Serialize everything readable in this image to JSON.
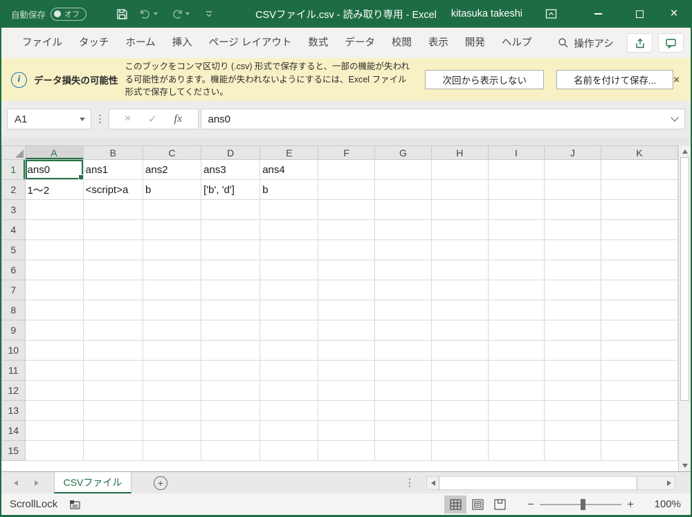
{
  "window": {
    "title": "CSVファイル.csv  -  読み取り専用  -  Excel",
    "user": "kitasuka takeshi"
  },
  "titlebar": {
    "autosave_label": "自動保存",
    "autosave_state": "オフ"
  },
  "ribbon": {
    "tabs": [
      {
        "id": "file",
        "label": "ファイル"
      },
      {
        "id": "touch",
        "label": "タッチ"
      },
      {
        "id": "home",
        "label": "ホーム"
      },
      {
        "id": "insert",
        "label": "挿入"
      },
      {
        "id": "page-layout",
        "label": "ページ レイアウト"
      },
      {
        "id": "formulas",
        "label": "数式"
      },
      {
        "id": "data",
        "label": "データ"
      },
      {
        "id": "review",
        "label": "校閲"
      },
      {
        "id": "view",
        "label": "表示"
      },
      {
        "id": "developer",
        "label": "開発"
      },
      {
        "id": "help",
        "label": "ヘルプ"
      }
    ],
    "search_label": "操作アシ"
  },
  "message_bar": {
    "title": "データ損失の可能性",
    "message": "このブックをコンマ区切り (.csv) 形式で保存すると、一部の機能が失われる可能性があります。機能が失われないようにするには、Excel ファイル形式で保存してください。",
    "dismiss_button": "次回から表示しない",
    "save_as_button": "名前を付けて保存...",
    "close_glyph": "×"
  },
  "formula_bar": {
    "name_box": "A1",
    "formula": "ans0",
    "cancel_glyph": "×",
    "enter_glyph": "✓",
    "fx_glyph": "fx"
  },
  "grid": {
    "columns": [
      "A",
      "B",
      "C",
      "D",
      "E",
      "F",
      "G",
      "H",
      "I",
      "J",
      "K"
    ],
    "row_count": 15,
    "selected_cell": "A1",
    "cells": {
      "A1": "ans0",
      "B1": "ans1",
      "C1": "ans2",
      "D1": "ans3",
      "E1": "ans4",
      "A2": " 1～2",
      "B2": "<script>a",
      "C2": "b",
      "D2": "['b', 'd']",
      "E2": "b"
    }
  },
  "sheet_bar": {
    "active_tab": "CSVファイル",
    "add_sheet_glyph": "+"
  },
  "status_bar": {
    "left_text": "ScrollLock",
    "zoom_minus_glyph": "−",
    "zoom_plus_glyph": "+",
    "zoom_level": "100%"
  },
  "colors": {
    "title_green": "#1E6C43",
    "accent_green": "#217346",
    "message_yellow": "#F8F1C6",
    "selection_header_gray": "#D6D6D6"
  }
}
